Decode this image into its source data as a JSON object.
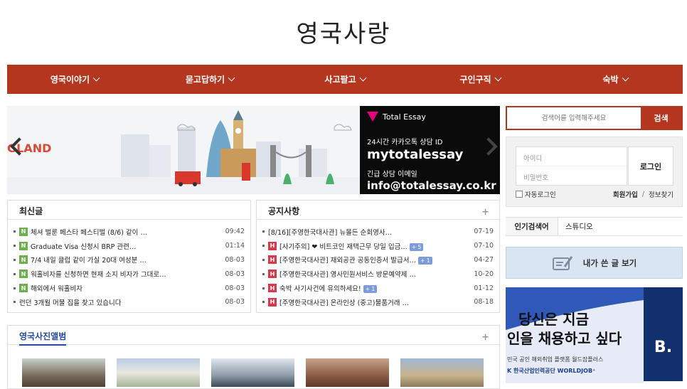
{
  "site": {
    "logo": "영국사랑"
  },
  "nav": [
    {
      "label": "영국이야기"
    },
    {
      "label": "묻고답하기"
    },
    {
      "label": "사고팔고"
    },
    {
      "label": "구인구직"
    },
    {
      "label": "숙박"
    }
  ],
  "banner": {
    "left_text": "GLAND",
    "brand": "Total Essay",
    "line1": "24시간 카카오톡 상담 ID",
    "line2": "mytotalessay",
    "line3": "긴급 상담 이메일",
    "line4": "info@totalessay.co.kr"
  },
  "latest": {
    "title": "최신글",
    "rows": [
      {
        "badge": "N",
        "title": "체셔 벌룬 페스타 페스티벌 (8/6) 같이 …",
        "date": "09:42"
      },
      {
        "badge": "N",
        "title": "Graduate Visa 신청시 BRP 관련…",
        "date": "01:14"
      },
      {
        "badge": "N",
        "title": "7/4 내일 클럽 같이 가실 20대 여성분 …",
        "date": "08-03"
      },
      {
        "badge": "N",
        "title": "워홀비자를 신청하면 현재 소지 비자가 그대로…",
        "date": "08-03"
      },
      {
        "badge": "N",
        "title": "해외에서 워홀비자",
        "date": "08-03"
      },
      {
        "badge": "",
        "title": "런던 3개월 머물 집을 찾고 있습니다",
        "date": "08-03"
      }
    ]
  },
  "notice": {
    "title": "공지사항",
    "plus": "+",
    "rows": [
      {
        "badge": "",
        "title": "[8/16][주영한국대사관] 뉴몰든 순회영사…",
        "count": "",
        "date": "07-19"
      },
      {
        "badge": "H",
        "title": "[사기주의] ❤ 비트코인 재택근무 당일 입금…",
        "count": "+ 5",
        "date": "07-10"
      },
      {
        "badge": "H",
        "title": "[주영한국대사관] 재외공관 공동인증서 발급서…",
        "count": "+ 1",
        "date": "04-27"
      },
      {
        "badge": "H",
        "title": "[주영한국대사관] 영사민원서비스 방문예약제 …",
        "count": "",
        "date": "10-20"
      },
      {
        "badge": "H",
        "title": "숙박 사기사건에 유의하세요!",
        "count": "+ 1",
        "date": "01-12"
      },
      {
        "badge": "H",
        "title": "[주영한국대사관] 온라인상 (중고)물품거래 …",
        "count": "",
        "date": "08-18"
      }
    ]
  },
  "album": {
    "title": "영국사진앨범",
    "plus": "+"
  },
  "search": {
    "placeholder": "검색어를 입력해주세요",
    "button": "검색"
  },
  "login": {
    "id_placeholder": "아이디",
    "pw_placeholder": "비밀번호",
    "button": "로그인",
    "auto_login": "자동로그인",
    "signup": "회원가입",
    "sep": "/",
    "find_info": "정보찾기"
  },
  "popular": {
    "label": "인기검색어",
    "item": "스튜디오"
  },
  "my_posts": {
    "label": "내가 쓴 글 보기"
  },
  "ad": {
    "line1": "당신은 지금",
    "line2": "인을 채용하고 싶다",
    "line3": "민국 공인 해외취업 플랫폼 월드잡플러스",
    "line4": "K 한국산업인력공단 WORLDJOB⁺",
    "side": "B."
  },
  "colors": {
    "brand_red": "#b5361f",
    "new_badge": "#6ab04c",
    "hot_badge": "#d63a4a"
  }
}
